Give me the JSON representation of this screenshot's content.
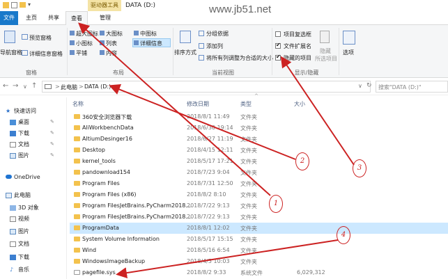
{
  "window": {
    "context_tab": "驱动器工具",
    "title": "DATA (D:)",
    "watermark": "www.jb51.net"
  },
  "tabs": [
    {
      "label": "文件"
    },
    {
      "label": "主页"
    },
    {
      "label": "共享"
    },
    {
      "label": "查看"
    },
    {
      "label": "管理"
    }
  ],
  "ribbon": {
    "panes": {
      "nav_pane": "导航窗格",
      "preview_pane": "预览窗格",
      "details_pane": "详细信息窗格",
      "group_label": "窗格"
    },
    "layout": {
      "xl_icons": "超大图标",
      "l_icons": "大图标",
      "m_icons": "中图标",
      "s_icons": "小图标",
      "list": "列表",
      "details": "详细信息",
      "tiles": "平铺",
      "content": "内容",
      "group_label": "布局"
    },
    "current_view": {
      "sort_by": "排序方式",
      "group_by": "分组依据",
      "add_columns": "添加列",
      "fit_columns": "将所有列调整为合适的大小",
      "group_label": "当前视图"
    },
    "show_hide": {
      "item_checkboxes": "项目复选框",
      "file_extensions": "文件扩展名",
      "hidden_items": "隐藏的项目",
      "hide_selected_1": "隐藏",
      "hide_selected_2": "所选项目",
      "options": "选项",
      "group_label": "显示/隐藏"
    }
  },
  "address": {
    "crumb_pc": "此电脑",
    "crumb_sep": ">",
    "crumb_drive": "DATA (D:)",
    "search_placeholder": "搜索\"DATA (D:)\""
  },
  "nav_pane": {
    "items": [
      {
        "label": "快速访问"
      },
      {
        "label": "桌面"
      },
      {
        "label": "下载"
      },
      {
        "label": "文档"
      },
      {
        "label": "图片"
      },
      {
        "label": "OneDrive"
      },
      {
        "label": "此电脑"
      },
      {
        "label": "3D 对象"
      },
      {
        "label": "视频"
      },
      {
        "label": "图片"
      },
      {
        "label": "文档"
      },
      {
        "label": "下载"
      },
      {
        "label": "音乐"
      }
    ]
  },
  "columns": {
    "name": "名称",
    "date": "修改日期",
    "type": "类型",
    "size": "大小"
  },
  "files": [
    {
      "name": "360安全浏览器下载",
      "date": "2018/8/1 11:49",
      "type": "文件夹",
      "size": ""
    },
    {
      "name": "AliWorkbenchData",
      "date": "2018/6/30 19:14",
      "type": "文件夹",
      "size": ""
    },
    {
      "name": "AltiumDesinger16",
      "date": "2018/6/27 11:19",
      "type": "文件夹",
      "size": ""
    },
    {
      "name": "Desktop",
      "date": "2018/4/15 12:11",
      "type": "文件夹",
      "size": ""
    },
    {
      "name": "kernel_tools",
      "date": "2018/5/17 17:21",
      "type": "文件夹",
      "size": ""
    },
    {
      "name": "pandownload154",
      "date": "2018/7/23 9:04",
      "type": "文件夹",
      "size": ""
    },
    {
      "name": "Program Files",
      "date": "2018/7/31 12:50",
      "type": "文件夹",
      "size": ""
    },
    {
      "name": "Program Files (x86)",
      "date": "2018/8/2 8:10",
      "type": "文件夹",
      "size": ""
    },
    {
      "name": "Program FilesJetBrains.PyCharm2018...",
      "date": "2018/7/22 9:13",
      "type": "文件夹",
      "size": ""
    },
    {
      "name": "Program FilesJetBrains.PyCharm2018...",
      "date": "2018/7/22 9:13",
      "type": "文件夹",
      "size": ""
    },
    {
      "name": "ProgramData",
      "date": "2018/8/1 12:02",
      "type": "文件夹",
      "size": ""
    },
    {
      "name": "System Volume Information",
      "date": "2018/5/17 15:15",
      "type": "文件夹",
      "size": ""
    },
    {
      "name": "Wind",
      "date": "2018/5/16 6:54",
      "type": "文件夹",
      "size": ""
    },
    {
      "name": "WindowsImageBackup",
      "date": "2018/4/5 10:03",
      "type": "文件夹",
      "size": ""
    },
    {
      "name": "pagefile.sys",
      "date": "2018/8/2 9:33",
      "type": "系统文件",
      "size": "6,029,312"
    }
  ],
  "selected_row": "ProgramData",
  "annotations": [
    "1",
    "2",
    "3",
    "4"
  ],
  "colors": {
    "file_tab": "#1979ca",
    "selection": "#cce8ff",
    "annotation": "#cc2222",
    "folder": "#f3c24d"
  }
}
